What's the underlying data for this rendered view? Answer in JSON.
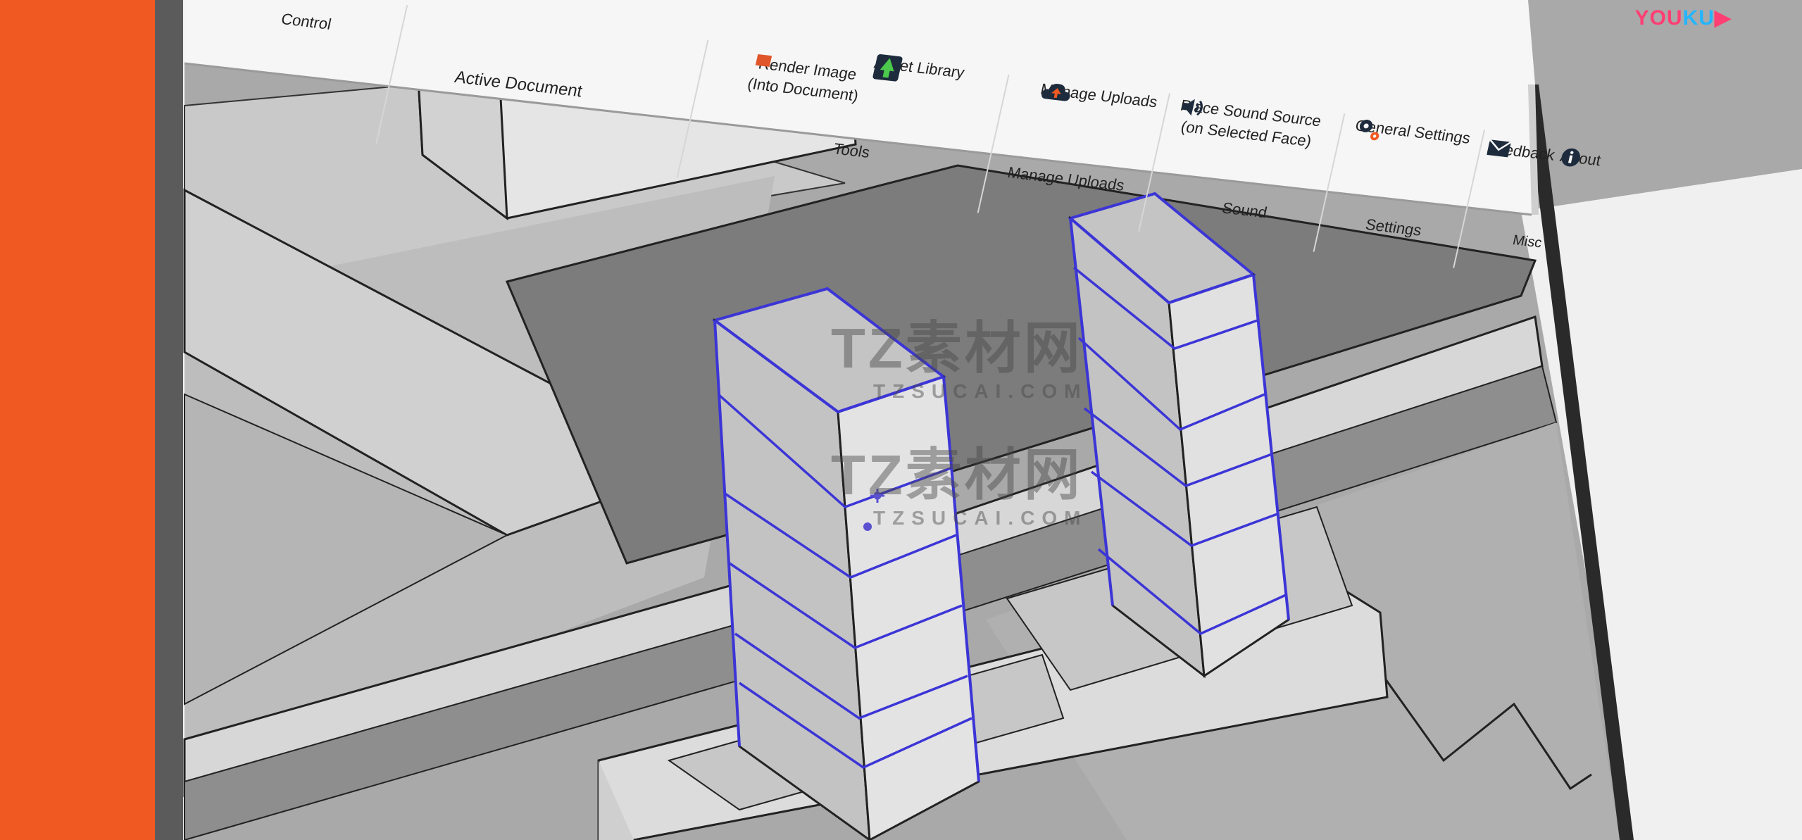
{
  "ribbon": {
    "control_label": "Control",
    "active_document_label": "Active Document",
    "render_image_label_1": "Render Image",
    "render_image_label_2": "(Into Document)",
    "asset_library_label": "Asset Library",
    "tools_group": "Tools",
    "manage_uploads_button": "Manage Uploads",
    "manage_uploads_group": "Manage Uploads",
    "place_sound_label_1": "Place Sound Source",
    "place_sound_label_2": "(on Selected Face)",
    "sound_group": "Sound",
    "general_settings_label": "General Settings",
    "settings_group": "Settings",
    "feedback_label": "Feedback",
    "about_label": "About",
    "misc_group": "Misc"
  },
  "brand": {
    "logo_you": "YOU",
    "logo_ku": "KU"
  },
  "watermark": [
    {
      "title": "TZ素材网",
      "sub": "TZSUCAI.COM"
    },
    {
      "title": "TZ素材网",
      "sub": "TZSUCAI.COM"
    }
  ],
  "colors": {
    "accent_orange": "#f05a22",
    "selection_blue": "#3c35d6",
    "youku_pink": "#ff3f73",
    "youku_blue": "#25b5ff"
  }
}
